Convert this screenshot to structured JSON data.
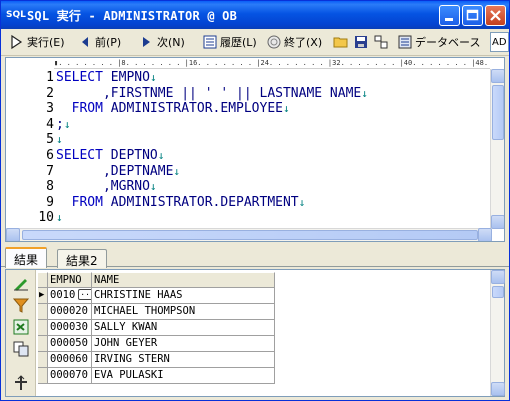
{
  "window": {
    "title": "SQL 実行 - ADMINISTRATOR @ OB",
    "icon_text": "SQL"
  },
  "toolbar": {
    "execute_label": "実行(E)",
    "prev_label": "前(P)",
    "next_label": "次(N)",
    "history_label": "履歴(L)",
    "exit_label": "終了(X)",
    "database_label": "データベース",
    "db_combo_value": "AD"
  },
  "editor": {
    "ruler_text": "▮. . . . . . . |8. . . . . . . |16. . . . . . . |24. . . . . . . |32. . . . . . . |40. . . . . . . |48. .",
    "line_numbers": [
      "1",
      "2",
      "3",
      "4",
      "5",
      "6",
      "7",
      "8",
      "9",
      "10"
    ],
    "lines": [
      "SELECT EMPNO",
      "      ,FIRSTNME || ' ' || LASTNAME NAME",
      "  FROM ADMINISTRATOR.EMPLOYEE",
      ";",
      "",
      "SELECT DEPTNO",
      "      ,DEPTNAME",
      "      ,MGRNO",
      "  FROM ADMINISTRATOR.DEPARTMENT",
      ""
    ],
    "eol_mark": "↓",
    "cursor_line": 10
  },
  "tabs": [
    {
      "label": "結果",
      "active": true
    },
    {
      "label": "結果2",
      "active": false
    }
  ],
  "results": {
    "columns": [
      "EMPNO",
      "NAME"
    ],
    "rows": [
      {
        "empno": "0010",
        "name": "CHRISTINE HAAS"
      },
      {
        "empno": "000020",
        "name": "MICHAEL THOMPSON"
      },
      {
        "empno": "000030",
        "name": "SALLY KWAN"
      },
      {
        "empno": "000050",
        "name": "JOHN GEYER"
      },
      {
        "empno": "000060",
        "name": "IRVING STERN"
      },
      {
        "empno": "000070",
        "name": "EVA PULASKI"
      }
    ],
    "current_row_marker": "▶",
    "ellipsis_button": "···"
  },
  "colors": {
    "titlebar": "#0554e3",
    "keyword": "#0000c0",
    "eol": "#008080",
    "active_tab_accent": "#f1a12a"
  }
}
